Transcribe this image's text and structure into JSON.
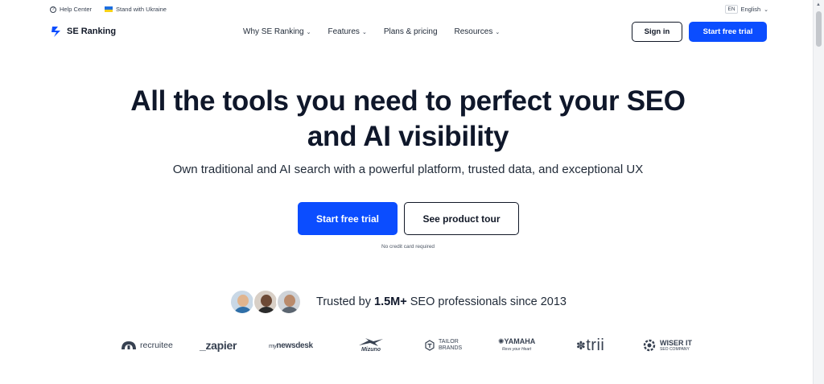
{
  "topbar": {
    "help_label": "Help Center",
    "ukraine_label": "Stand with Ukraine",
    "lang_code": "EN",
    "lang_label": "English"
  },
  "header": {
    "brand": "SE Ranking",
    "nav": [
      {
        "label": "Why SE Ranking",
        "dropdown": true
      },
      {
        "label": "Features",
        "dropdown": true
      },
      {
        "label": "Plans & pricing",
        "dropdown": false
      },
      {
        "label": "Resources",
        "dropdown": true
      }
    ],
    "signin_label": "Sign in",
    "trial_label": "Start free trial"
  },
  "hero": {
    "title_line1": "All the tools you need to perfect your SEO",
    "title_line2": "and AI visibility",
    "subtitle": "Own traditional and AI search with a powerful platform, trusted data, and exceptional UX",
    "primary_cta": "Start free trial",
    "secondary_cta": "See product tour",
    "note": "No credit card required"
  },
  "trust": {
    "prefix": "Trusted by ",
    "highlight": "1.5M+",
    "suffix": " SEO professionals since 2013"
  },
  "logos": {
    "recruitee": "recruitee",
    "zapier": "_zapier",
    "mynewsdesk_prefix": "my",
    "mynewsdesk": "newsdesk",
    "mizuno": "Mizuno",
    "tailor_line1": "TAILOR",
    "tailor_line2": "BRANDS",
    "yamaha": "YAMAHA",
    "yamaha_tag": "Revs your Heart",
    "trii": "trii",
    "wiser_line1": "WISER IT",
    "wiser_line2": "SEO COMPANY"
  },
  "colors": {
    "accent": "#0b4dff",
    "text": "#0f172a"
  }
}
